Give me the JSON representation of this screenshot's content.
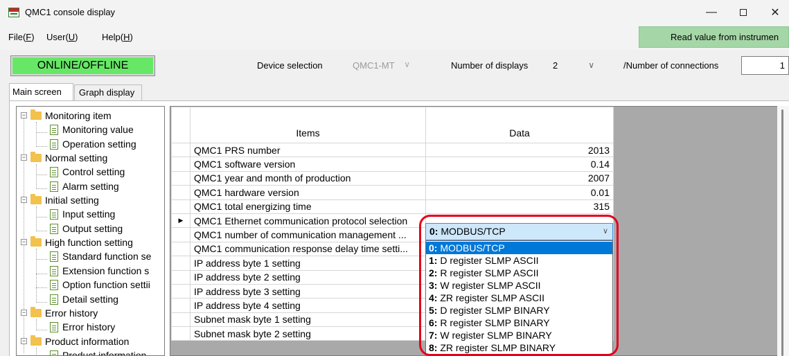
{
  "window": {
    "title": "QMC1 console display"
  },
  "menu": {
    "file": "File(",
    "file_key": "F",
    "user": "User(",
    "user_key": "U",
    "help": "Help(",
    "help_key": "H",
    "close_paren": ")"
  },
  "toolbar": {
    "read_value": "Read value from instrumen",
    "online_offline": "ONLINE/OFFLINE",
    "device_label": "Device selection",
    "device_value": "QMC1-MT",
    "displays_label": "Number of displays",
    "displays_value": "2",
    "connections_label": "/Number of connections",
    "connections_value": "1"
  },
  "tabs": {
    "main": "Main screen",
    "graph": "Graph display"
  },
  "tree": {
    "monitoring_item": "Monitoring item",
    "monitoring_value": "Monitoring value",
    "operation_setting": "Operation setting",
    "normal_setting": "Normal setting",
    "control_setting": "Control setting",
    "alarm_setting": "Alarm setting",
    "initial_setting": "Initial setting",
    "input_setting": "Input setting",
    "output_setting": "Output setting",
    "high_function_setting": "High function setting",
    "standard_function": "Standard function se",
    "extension_function": "Extension function s",
    "option_function": "Option function settii",
    "detail_setting": "Detail setting",
    "error_history": "Error history",
    "error_history_child": "Error history",
    "product_information": "Product information",
    "product_information_child": "Product information"
  },
  "grid": {
    "col_items": "Items",
    "col_data": "Data",
    "rows": [
      {
        "item": "QMC1 PRS number",
        "data": "2013"
      },
      {
        "item": "QMC1 software version",
        "data": "0.14"
      },
      {
        "item": "QMC1 year and month of production",
        "data": "2007"
      },
      {
        "item": "QMC1 hardware version",
        "data": "0.01"
      },
      {
        "item": "QMC1 total energizing time",
        "data": "315"
      },
      {
        "item": "QMC1 Ethernet communication protocol selection",
        "data": ""
      },
      {
        "item": "QMC1 number of communication management ...",
        "data": ""
      },
      {
        "item": "QMC1 communication response delay time setti...",
        "data": ""
      },
      {
        "item": "IP address byte 1 setting",
        "data": ""
      },
      {
        "item": "IP address byte 2 setting",
        "data": ""
      },
      {
        "item": "IP address byte 3 setting",
        "data": ""
      },
      {
        "item": "IP address byte 4 setting",
        "data": ""
      },
      {
        "item": "Subnet mask byte 1 setting",
        "data": ""
      },
      {
        "item": "Subnet mask byte 2 setting",
        "data": ""
      }
    ]
  },
  "protocol": {
    "selected": {
      "num": "0:",
      "text": " MODBUS/TCP"
    },
    "options": [
      {
        "num": "0:",
        "text": " MODBUS/TCP"
      },
      {
        "num": "1:",
        "text": " D register SLMP ASCII"
      },
      {
        "num": "2:",
        "text": " R register SLMP ASCII"
      },
      {
        "num": "3:",
        "text": " W register SLMP ASCII"
      },
      {
        "num": "4:",
        "text": " ZR register SLMP ASCII"
      },
      {
        "num": "5:",
        "text": " D register SLMP BINARY"
      },
      {
        "num": "6:",
        "text": " R register SLMP BINARY"
      },
      {
        "num": "7:",
        "text": " W register SLMP BINARY"
      },
      {
        "num": "8:",
        "text": " ZR register SLMP BINARY"
      }
    ]
  },
  "colors": {
    "online": "#66e866",
    "read_value_bg": "#a5d6a7",
    "selection": "#0078d7",
    "highlight": "#e3001b"
  }
}
